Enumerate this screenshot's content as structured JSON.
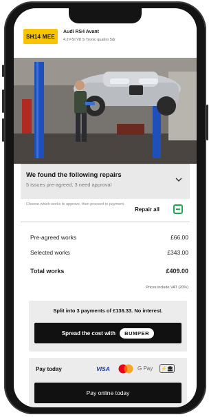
{
  "vehicle": {
    "plate": "SH14 MEE",
    "name": "Audi RS4 Avant",
    "spec": "4.2 FSI V8 S Tronic quattro 5dr"
  },
  "repairs": {
    "title": "We found the following repairs",
    "subtitle": "5 issues pre-agreed, 3 need approval",
    "hint": "Choose which works to approve, then proceed to payment.",
    "repair_all_label": "Repair all"
  },
  "pricing": {
    "rows": [
      {
        "label": "Pre-agreed works",
        "value": "£66.00"
      },
      {
        "label": "Selected works",
        "value": "£343.00"
      }
    ],
    "total_label": "Total works",
    "total_value": "£409.00",
    "vat_note": "Prices include VAT (20%)"
  },
  "split": {
    "text": "Split into 3 payments of £136.33. No interest.",
    "button_label": "Spread the cost with",
    "brand": "BUMPER"
  },
  "payment": {
    "label": "Pay today",
    "methods": {
      "visa": "VISA",
      "gpay": "G Pay",
      "openbanking": "⚡🏛"
    },
    "button_label": "Pay online today"
  },
  "colors": {
    "plate": "#f6c400",
    "toggle": "#1aa84f",
    "button": "#111111"
  }
}
